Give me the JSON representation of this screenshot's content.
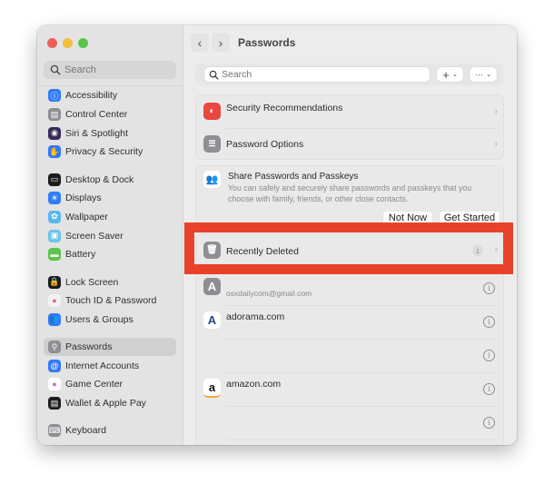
{
  "window": {
    "traffic_lights": [
      "close",
      "minimize",
      "zoom"
    ]
  },
  "sidebar": {
    "search_placeholder": "Search",
    "groups": [
      [
        {
          "label": "Accessibility",
          "icon": "accessibility-icon",
          "color": "#2f7df6"
        },
        {
          "label": "Control Center",
          "icon": "control-center-icon",
          "color": "#8e8e93"
        },
        {
          "label": "Siri & Spotlight",
          "icon": "siri-icon",
          "color": "#3a2a5a"
        },
        {
          "label": "Privacy & Security",
          "icon": "hand-icon",
          "color": "#3478f6"
        }
      ],
      [
        {
          "label": "Desktop & Dock",
          "icon": "dock-icon",
          "color": "#1c1c1e"
        },
        {
          "label": "Displays",
          "icon": "sun-icon",
          "color": "#2f7df6"
        },
        {
          "label": "Wallpaper",
          "icon": "flower-icon",
          "color": "#5ab8f0"
        },
        {
          "label": "Screen Saver",
          "icon": "screen-saver-icon",
          "color": "#6ac4ec"
        },
        {
          "label": "Battery",
          "icon": "battery-icon",
          "color": "#5cc449"
        }
      ],
      [
        {
          "label": "Lock Screen",
          "icon": "lock-icon",
          "color": "#1c1c1e"
        },
        {
          "label": "Touch ID & Password",
          "icon": "fingerprint-icon",
          "color": "#f2f2f2"
        },
        {
          "label": "Users & Groups",
          "icon": "users-icon",
          "color": "#3478f6"
        }
      ],
      [
        {
          "label": "Passwords",
          "icon": "key-icon",
          "color": "#8e8e93",
          "active": true
        },
        {
          "label": "Internet Accounts",
          "icon": "at-icon",
          "color": "#3478f6"
        },
        {
          "label": "Game Center",
          "icon": "game-center-icon",
          "color": "#ffffff"
        },
        {
          "label": "Wallet & Apple Pay",
          "icon": "wallet-icon",
          "color": "#1c1c1e"
        }
      ],
      [
        {
          "label": "Keyboard",
          "icon": "keyboard-icon",
          "color": "#8e8e93"
        }
      ]
    ]
  },
  "main": {
    "title": "Passwords",
    "back_icon": "‹",
    "forward_icon": "›",
    "search_placeholder": "Search",
    "add_button": "+",
    "more_button": "···",
    "security_recommendations": "Security Recommendations",
    "password_options": "Password Options",
    "share": {
      "title": "Share Passwords and Passkeys",
      "description": "You can safely and securely share passwords and passkeys that you choose with family, friends, or other close contacts.",
      "not_now": "Not Now",
      "get_started": "Get Started"
    },
    "recently_deleted": {
      "label": "Recently Deleted",
      "count": "1"
    },
    "entries": [
      {
        "title": "",
        "subtitle": "osxdailycom@gmail.com",
        "icon_letter": "A",
        "icon": "letter-a-icon"
      },
      {
        "title": "adorama.com",
        "subtitle": "",
        "icon_letter": "A",
        "icon": "adorama-icon"
      },
      {
        "title": "",
        "subtitle": "",
        "icon_letter": "",
        "icon": ""
      },
      {
        "title": "amazon.com",
        "subtitle": "",
        "icon_letter": "a",
        "icon": "amazon-icon"
      },
      {
        "title": "",
        "subtitle": "",
        "icon_letter": "",
        "icon": ""
      }
    ],
    "highlight_color": "#e8422a"
  }
}
